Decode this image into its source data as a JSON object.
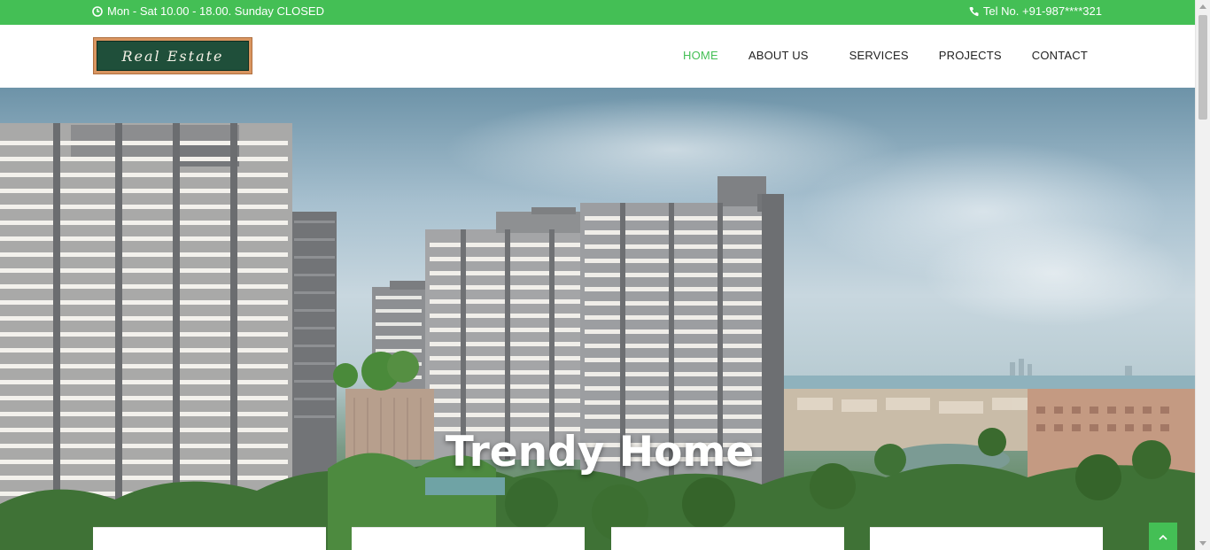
{
  "topbar": {
    "hours_icon": "clock-icon",
    "hours_text": "Mon - Sat 10.00 - 18.00. Sunday CLOSED",
    "phone_icon": "phone-icon",
    "phone_text": "Tel No. +91-987****321"
  },
  "logo": {
    "text": "Real Estate"
  },
  "nav": {
    "items": [
      {
        "label": "HOME",
        "active": true
      },
      {
        "label": "ABOUT US"
      },
      {
        "label": "SERVICES"
      },
      {
        "label": "PROJECTS"
      },
      {
        "label": "CONTACT"
      }
    ]
  },
  "hero": {
    "title": "Trendy Home"
  },
  "colors": {
    "accent": "#44bf55"
  },
  "feature_cards": [
    {
      "icon": "feature-icon-1"
    },
    {
      "icon": "feature-icon-2"
    },
    {
      "icon": "feature-icon-3"
    },
    {
      "icon": "feature-icon-4"
    }
  ],
  "back_to_top_icon": "chevron-up-icon"
}
